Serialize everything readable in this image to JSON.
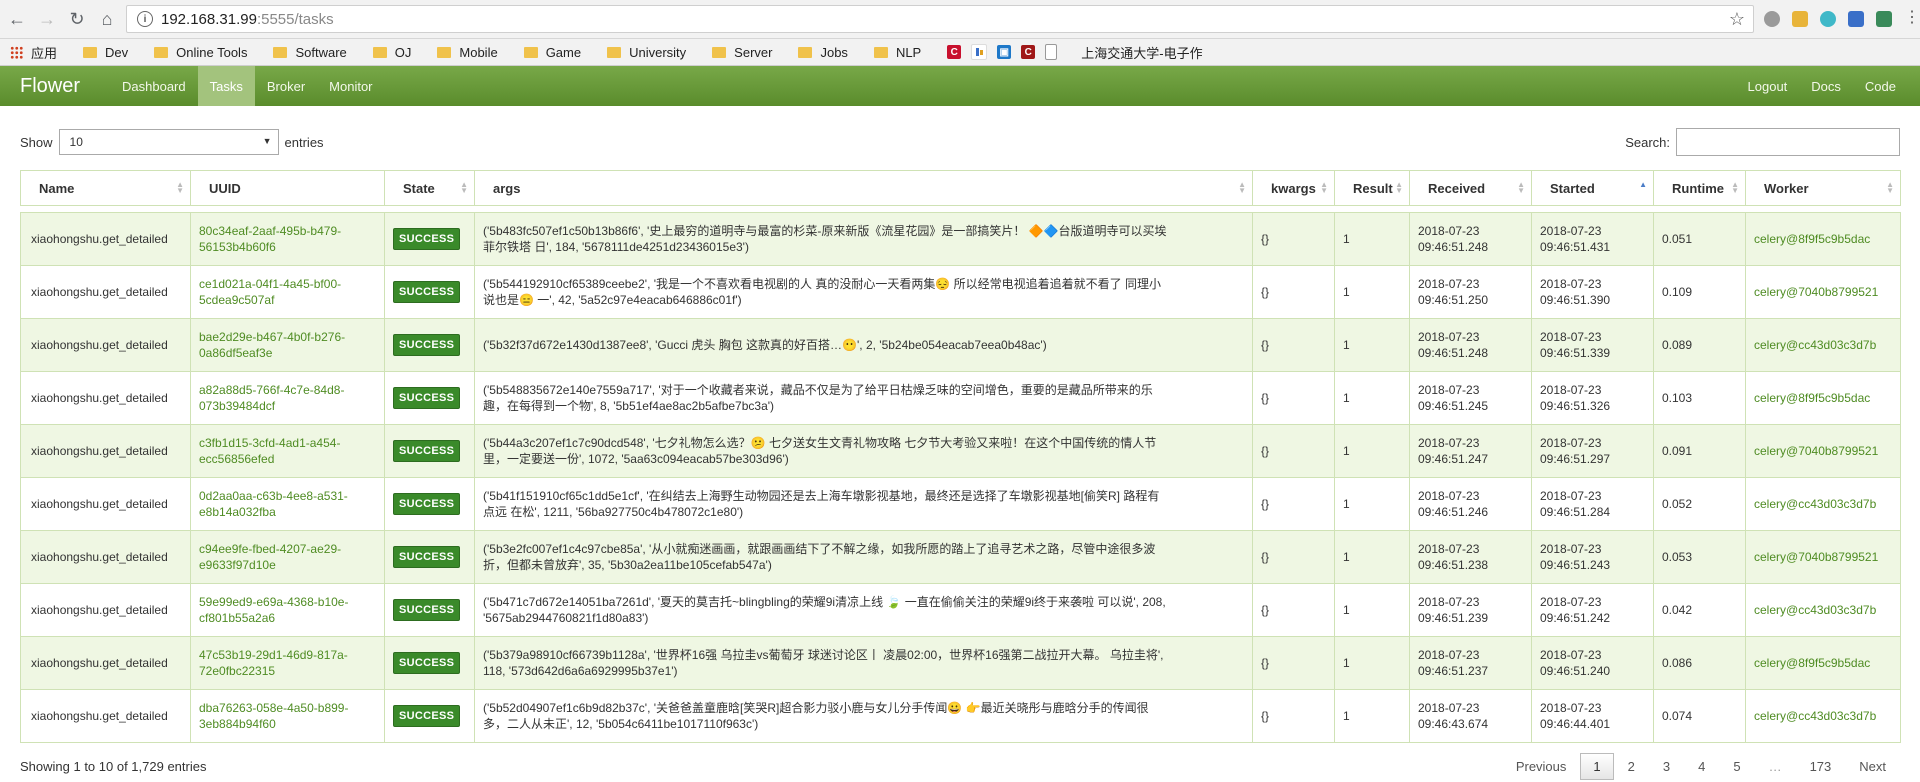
{
  "browser": {
    "url_host": "192.168.31.99",
    "url_rest": ":5555/tasks",
    "bookmarks": [
      "应用",
      "Dev",
      "Online Tools",
      "Software",
      "OJ",
      "Mobile",
      "Game",
      "University",
      "Server",
      "Jobs",
      "NLP",
      "上海交通大学-电子作"
    ]
  },
  "navbar": {
    "brand": "Flower",
    "links": [
      "Dashboard",
      "Tasks",
      "Broker",
      "Monitor"
    ],
    "right_links": [
      "Logout",
      "Docs",
      "Code"
    ]
  },
  "controls": {
    "show_label": "Show",
    "entries_value": "10",
    "entries_label": "entries",
    "search_label": "Search:"
  },
  "table": {
    "headers": [
      "Name",
      "UUID",
      "State",
      "args",
      "kwargs",
      "Result",
      "Received",
      "Started",
      "Runtime",
      "Worker"
    ],
    "rows": [
      {
        "name": "xiaohongshu.get_detailed",
        "uuid": [
          "80c34eaf-2aaf-495b-b479-",
          "56153b4b60f6"
        ],
        "state": "SUCCESS",
        "args": [
          "('5b483fc507ef1c50b13b86f6', '史上最穷的道明寺与最富的杉菜-原来新版《流星花园》是一部搞笑片！ 🔶🔷台版道明寺可以买埃",
          "菲尔铁塔 日', 184, '5678111de4251d23436015e3')"
        ],
        "kwargs": "{}",
        "result": "1",
        "received": [
          "2018-07-23",
          "09:46:51.248"
        ],
        "started": [
          "2018-07-23",
          "09:46:51.431"
        ],
        "runtime": "0.051",
        "worker": "celery@8f9f5c9b5dac"
      },
      {
        "name": "xiaohongshu.get_detailed",
        "uuid": [
          "ce1d021a-04f1-4a45-bf00-",
          "5cdea9c507af"
        ],
        "state": "SUCCESS",
        "args": [
          "('5b544192910cf65389ceebe2', '我是一个不喜欢看电视剧的人 真的没耐心一天看两集😔 所以经常电视追着追着就不看了 同理小",
          "说也是😑 一', 42, '5a52c97e4eacab646886c01f')"
        ],
        "kwargs": "{}",
        "result": "1",
        "received": [
          "2018-07-23",
          "09:46:51.250"
        ],
        "started": [
          "2018-07-23",
          "09:46:51.390"
        ],
        "runtime": "0.109",
        "worker": "celery@7040b8799521"
      },
      {
        "name": "xiaohongshu.get_detailed",
        "uuid": [
          "bae2d29e-b467-4b0f-b276-",
          "0a86df5eaf3e"
        ],
        "state": "SUCCESS",
        "args": [
          "('5b32f37d672e1430d1387ee8', 'Gucci 虎头 胸包 这款真的好百搭…😶', 2, '5b24be054eacab7eea0b48ac')"
        ],
        "kwargs": "{}",
        "result": "1",
        "received": [
          "2018-07-23",
          "09:46:51.248"
        ],
        "started": [
          "2018-07-23",
          "09:46:51.339"
        ],
        "runtime": "0.089",
        "worker": "celery@cc43d03c3d7b"
      },
      {
        "name": "xiaohongshu.get_detailed",
        "uuid": [
          "a82a88d5-766f-4c7e-84d8-",
          "073b39484dcf"
        ],
        "state": "SUCCESS",
        "args": [
          "('5b548835672e140e7559a717', '对于一个收藏者来说，藏品不仅是为了给平日枯燥乏味的空间增色，重要的是藏品所带来的乐",
          "趣，在每得到一个物', 8, '5b51ef4ae8ac2b5afbe7bc3a')"
        ],
        "kwargs": "{}",
        "result": "1",
        "received": [
          "2018-07-23",
          "09:46:51.245"
        ],
        "started": [
          "2018-07-23",
          "09:46:51.326"
        ],
        "runtime": "0.103",
        "worker": "celery@8f9f5c9b5dac"
      },
      {
        "name": "xiaohongshu.get_detailed",
        "uuid": [
          "c3fb1d15-3cfd-4ad1-a454-",
          "ecc56856efed"
        ],
        "state": "SUCCESS",
        "args": [
          "('5b44a3c207ef1c7c90dcd548', '七夕礼物怎么选？😕 七夕送女生文青礼物攻略 七夕节大考验又来啦！在这个中国传统的情人节",
          "里，一定要送一份', 1072, '5aa63c094eacab57be303d96')"
        ],
        "kwargs": "{}",
        "result": "1",
        "received": [
          "2018-07-23",
          "09:46:51.247"
        ],
        "started": [
          "2018-07-23",
          "09:46:51.297"
        ],
        "runtime": "0.091",
        "worker": "celery@7040b8799521"
      },
      {
        "name": "xiaohongshu.get_detailed",
        "uuid": [
          "0d2aa0aa-c63b-4ee8-a531-",
          "e8b14a032fba"
        ],
        "state": "SUCCESS",
        "args": [
          "('5b41f151910cf65c1dd5e1cf', '在纠结去上海野生动物园还是去上海车墩影视基地，最终还是选择了车墩影视基地[偷笑R] 路程有",
          "点远 在松', 1211, '56ba927750c4b478072c1e80')"
        ],
        "kwargs": "{}",
        "result": "1",
        "received": [
          "2018-07-23",
          "09:46:51.246"
        ],
        "started": [
          "2018-07-23",
          "09:46:51.284"
        ],
        "runtime": "0.052",
        "worker": "celery@cc43d03c3d7b"
      },
      {
        "name": "xiaohongshu.get_detailed",
        "uuid": [
          "c94ee9fe-fbed-4207-ae29-",
          "e9633f97d10e"
        ],
        "state": "SUCCESS",
        "args": [
          "('5b3e2fc007ef1c4c97cbe85a', '从小就痴迷画画，就跟画画结下了不解之缘，如我所愿的踏上了追寻艺术之路，尽管中途很多波",
          "折，但都未曾放弃', 35, '5b30a2ea11be105cefab547a')"
        ],
        "kwargs": "{}",
        "result": "1",
        "received": [
          "2018-07-23",
          "09:46:51.238"
        ],
        "started": [
          "2018-07-23",
          "09:46:51.243"
        ],
        "runtime": "0.053",
        "worker": "celery@7040b8799521"
      },
      {
        "name": "xiaohongshu.get_detailed",
        "uuid": [
          "59e99ed9-e69a-4368-b10e-",
          "cf801b55a2a6"
        ],
        "state": "SUCCESS",
        "args": [
          "('5b471c7d672e14051ba7261d', '夏天的莫吉托~blingbling的荣耀9i清凉上线 🍃 一直在偷偷关注的荣耀9i终于来袭啦 可以说', 208,",
          "'5675ab2944760821f1d80a83')"
        ],
        "kwargs": "{}",
        "result": "1",
        "received": [
          "2018-07-23",
          "09:46:51.239"
        ],
        "started": [
          "2018-07-23",
          "09:46:51.242"
        ],
        "runtime": "0.042",
        "worker": "celery@cc43d03c3d7b"
      },
      {
        "name": "xiaohongshu.get_detailed",
        "uuid": [
          "47c53b19-29d1-46d9-817a-",
          "72e0fbc22315"
        ],
        "state": "SUCCESS",
        "args": [
          "('5b379a98910cf66739b1128a', '世界杯16强 乌拉圭vs葡萄牙 球迷讨论区丨 凌晨02:00，世界杯16强第二战拉开大幕。 乌拉圭将',",
          "118, '573d642d6a6a6929995b37e1')"
        ],
        "kwargs": "{}",
        "result": "1",
        "received": [
          "2018-07-23",
          "09:46:51.237"
        ],
        "started": [
          "2018-07-23",
          "09:46:51.240"
        ],
        "runtime": "0.086",
        "worker": "celery@8f9f5c9b5dac"
      },
      {
        "name": "xiaohongshu.get_detailed",
        "uuid": [
          "dba76263-058e-4a50-b899-",
          "3eb884b94f60"
        ],
        "state": "SUCCESS",
        "args": [
          "('5b52d04907ef1c6b9d82b37c', '关爸爸盖童鹿晗[笑哭R]超合影力驳小鹿与女儿分手传闻😀 👉最近关晓彤与鹿晗分手的传闻很",
          "多，二人从未正', 12, '5b054c6411be1017110f963c')"
        ],
        "kwargs": "{}",
        "result": "1",
        "received": [
          "2018-07-23",
          "09:46:43.674"
        ],
        "started": [
          "2018-07-23",
          "09:46:44.401"
        ],
        "runtime": "0.074",
        "worker": "celery@cc43d03c3d7b"
      }
    ]
  },
  "footer": {
    "info": "Showing 1 to 10 of 1,729 entries",
    "pages": [
      "Previous",
      "1",
      "2",
      "3",
      "4",
      "5",
      "…",
      "173",
      "Next"
    ]
  },
  "colors": {
    "navbar": "#6a9a3a",
    "success": "#3a8a2a",
    "link": "#4f8c23",
    "row_alt": "#eff7e3"
  }
}
